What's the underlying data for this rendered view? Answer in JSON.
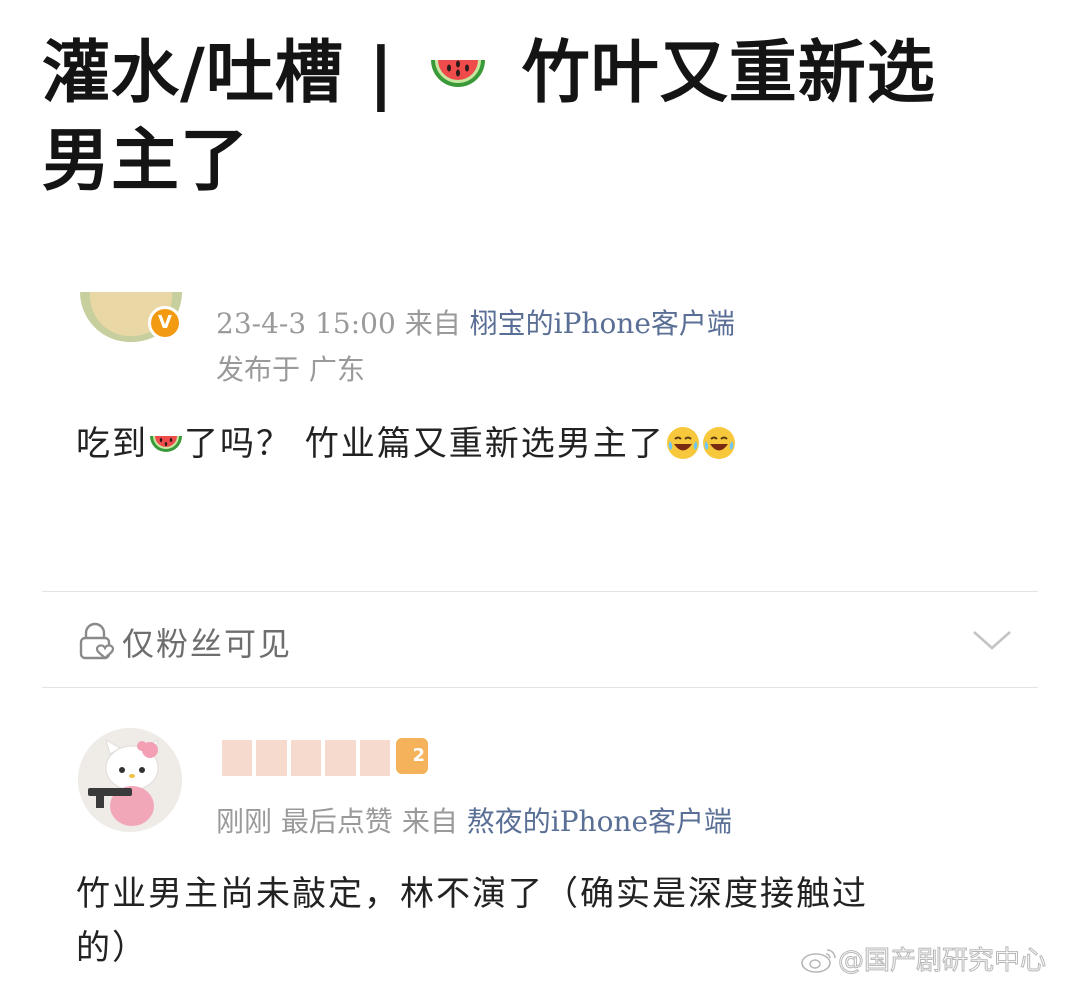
{
  "post": {
    "title_part1": "灌水/吐槽 | ",
    "title_part2": " 竹叶又重新选男主了",
    "title_emoji": "watermelon-icon"
  },
  "entry1": {
    "avatar_badge": "V",
    "timestamp": "23-4-3 15:00",
    "source_prefix": "来自",
    "source_client": "栩宝的iPhone客户端",
    "location": "发布于 广东",
    "text_part1": "吃到",
    "text_part2": "了吗？  竹业篇又重新选男主了",
    "emojis": [
      "watermelon-icon",
      "laughing-tears-icon",
      "laughing-tears-icon"
    ]
  },
  "visibility": {
    "label": "仅粉丝可见",
    "icon": "lock-heart-icon",
    "expand_icon": "chevron-down-icon"
  },
  "entry2": {
    "level_badge": "2",
    "time": "刚刚 最后点赞",
    "source_prefix": "来自",
    "source_client": "熬夜的iPhone客户端",
    "text_line1": "竹业男主尚未敲定，林不演了（确实是深度接触过",
    "text_line2": "的）"
  },
  "watermark": {
    "icon": "weibo-logo-icon",
    "text": "@国产剧研究中心"
  },
  "colors": {
    "source_link": "#5a6f95",
    "meta_gray": "#9a9a9a",
    "vip_badge": "#f29b12",
    "divider": "#e4e4e4"
  }
}
